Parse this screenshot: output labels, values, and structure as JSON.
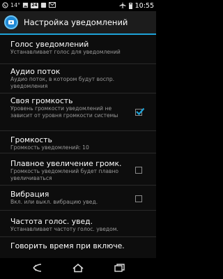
{
  "status_bar": {
    "time": "10:55",
    "signal_text": "14°",
    "notification_badge": "24",
    "icons": [
      "whatsapp-icon",
      "image-icon",
      "notification-icon",
      "mail-icon",
      "wifi-icon",
      "battery-icon",
      "airplane-icon"
    ]
  },
  "action_bar": {
    "title": "Настройка уведомлений",
    "icon": "app-icon"
  },
  "settings": [
    {
      "title": "Голос уведомлений",
      "summary": "Устанавливает голос для уведомлений",
      "checkbox": null
    },
    {
      "title": "Аудио поток",
      "summary": "Аудио поток, в котором будут воспр. уведомления",
      "checkbox": null
    },
    {
      "title": "Своя громкость",
      "summary": "Уровень громкости уведомлений не зависит от уровня громкости системы",
      "checkbox": true
    },
    {
      "title": "Громкость",
      "summary": "Громкость уведомлений: 10",
      "checkbox": null
    },
    {
      "title": "Плавное увеличение громк.",
      "summary": "Громкость уведомлений будет плавно увеличиваться",
      "checkbox": false
    },
    {
      "title": "Вибрация",
      "summary": "Вкл. или выкл. вибрацию увед.",
      "checkbox": false
    },
    {
      "title": "Частота голос. увед.",
      "summary": "Устанавливает частоту голос. уведом.",
      "checkbox": null
    },
    {
      "title": "Говорить время при включе.",
      "summary": "",
      "checkbox": null
    }
  ],
  "nav_bar": {
    "icons": [
      "back-icon",
      "home-icon",
      "recents-icon"
    ]
  },
  "colors": {
    "accent": "#1ea3d8",
    "checkbox": "#1ea3d8"
  }
}
